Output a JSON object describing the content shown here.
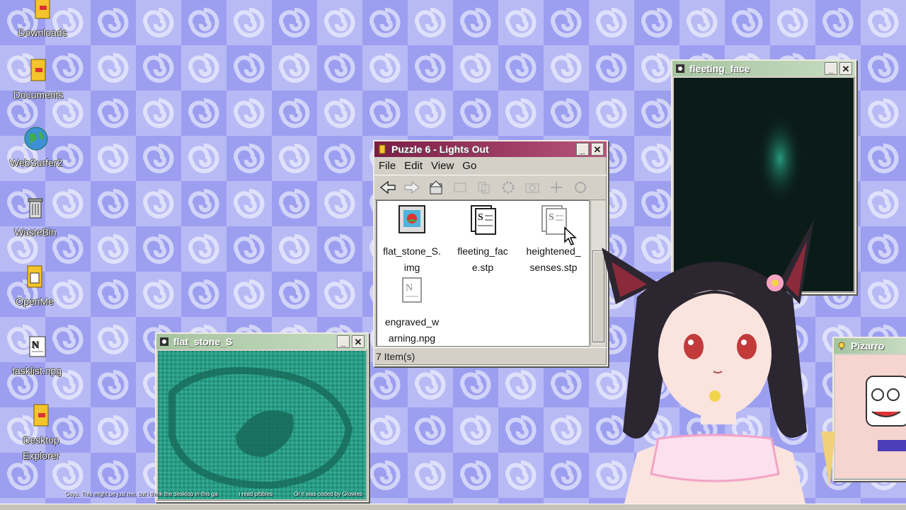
{
  "desktop": {
    "icons": [
      {
        "label": "Downloads",
        "icon": "folder-icon"
      },
      {
        "label": "Documents",
        "icon": "folder-icon"
      },
      {
        "label": "WebSurfer2",
        "icon": "globe-icon"
      },
      {
        "label": "WasteBin",
        "icon": "trash-icon"
      },
      {
        "label": "OpenMe",
        "icon": "folder-icon"
      },
      {
        "label": "tasklist.npg",
        "icon": "note-icon"
      },
      {
        "label": "Desktop Explorer",
        "icon": "folder-icon"
      }
    ]
  },
  "windows": {
    "puzzle": {
      "title": "Puzzle 6 - Lights Out",
      "menu": [
        "File",
        "Edit",
        "View",
        "Go"
      ],
      "files": [
        {
          "name": "flat_stone_S.img",
          "line1": "flat_stone_S.",
          "line2": "img",
          "icon": "image-file-icon"
        },
        {
          "name": "fleeting_face.stp",
          "line1": "fleeting_fac",
          "line2": "e.stp",
          "icon": "script-file-icon"
        },
        {
          "name": "heightened_senses.stp",
          "line1": "heightened_",
          "line2": "senses.stp",
          "icon": "script-file-icon"
        },
        {
          "name": "engraved_warning.npg",
          "line1": "engraved_w",
          "line2": "arning.npg",
          "icon": "note-icon"
        }
      ],
      "status": "7 Item(s)"
    },
    "fleeting_face": {
      "title": "fleeting_face"
    },
    "flat_stone": {
      "title": "flat_stone_S"
    },
    "pizarro": {
      "title": "Pizarro"
    }
  },
  "chat": [
    "Guys. This might be just me, but i think the desktop in this ga",
    "i read pibbles",
    "Or it was coded by Glowies"
  ],
  "colors": {
    "desktop_bg": "#9c9ff0",
    "puzzle_titlebar": "#7a1e45",
    "viewer_titlebar": "#a6c4a0",
    "teal_image": "#2a9c86"
  }
}
